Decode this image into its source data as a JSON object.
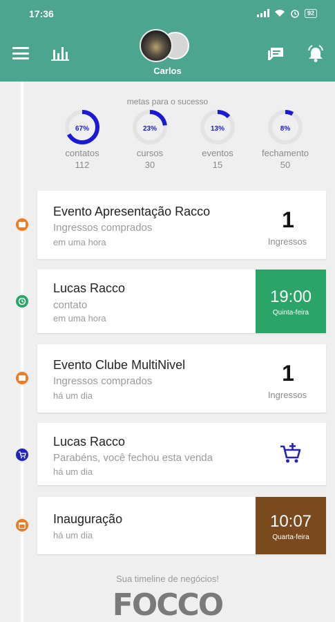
{
  "status": {
    "time": "17:36",
    "battery": "92"
  },
  "header": {
    "profile_name": "Carlos"
  },
  "goals": {
    "title": "metas para o sucesso",
    "items": [
      {
        "pct_label": "67%",
        "pct": 0.67,
        "label": "contatos",
        "count": "112"
      },
      {
        "pct_label": "23%",
        "pct": 0.23,
        "label": "cursos",
        "count": "30"
      },
      {
        "pct_label": "13%",
        "pct": 0.13,
        "label": "eventos",
        "count": "15"
      },
      {
        "pct_label": "8%",
        "pct": 0.08,
        "label": "fechamento",
        "count": "50"
      }
    ]
  },
  "timeline": [
    {
      "title": "Evento Apresentação Racco",
      "subtitle": "Ingressos comprados",
      "time": "em uma hora",
      "value": "1",
      "value_label": "Ingressos",
      "icon": "ticket-icon",
      "color": "#f07a22"
    },
    {
      "title": "Lucas Racco",
      "subtitle": "contato",
      "time": "em uma hora",
      "big_time": "19:00",
      "day": "Quinta-feira",
      "icon": "clock-icon",
      "color": "#2aa567"
    },
    {
      "title": "Evento Clube MultiNivel",
      "subtitle": "Ingressos comprados",
      "time": "há um dia",
      "value": "1",
      "value_label": "Ingressos",
      "icon": "ticket-icon",
      "color": "#f07a22"
    },
    {
      "title": "Lucas Racco",
      "subtitle": "Parabéns, você fechou esta venda",
      "time": "há um dia",
      "icon": "cart-plus-icon",
      "color": "#2424b8"
    },
    {
      "title": "Inauguração",
      "time": "há um dia",
      "big_time": "10:07",
      "day": "Quarta-feira",
      "icon": "calendar-icon",
      "color": "#f07a22",
      "box_color": "#7a4a1e"
    }
  ],
  "footer": {
    "text": "Sua timeline de negócios!",
    "logo": "FOCCO"
  }
}
